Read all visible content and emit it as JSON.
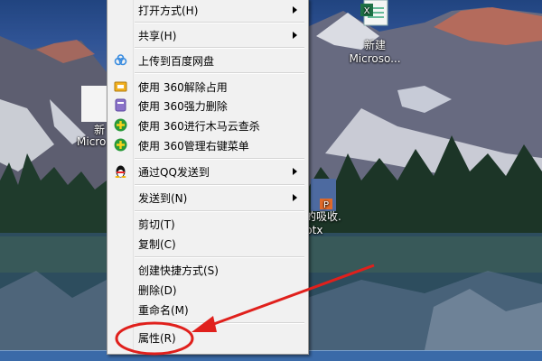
{
  "desktop": {
    "icons": [
      {
        "name": "desktop-icon-word-new",
        "label_line1": "新建",
        "label_line2": "Microso..."
      },
      {
        "name": "desktop-icon-left-partial",
        "label_line1": "新",
        "label_line2": "Micro"
      },
      {
        "name": "desktop-icon-ppt",
        "label_line1": "的吸收.",
        "label_line2": "ptx"
      }
    ]
  },
  "context_menu": {
    "items": [
      {
        "label": "打开方式(H)",
        "submenu": true
      },
      {
        "label": "共享(H)",
        "submenu": true
      },
      {
        "label": "上传到百度网盘",
        "icon": "baidu-cloud-icon"
      },
      {
        "label": "使用 360解除占用",
        "icon": "360-unlock-icon"
      },
      {
        "label": "使用 360强力删除",
        "icon": "360-shred-icon"
      },
      {
        "label": "使用 360进行木马云查杀",
        "icon": "360-scan-icon"
      },
      {
        "label": "使用 360管理右键菜单",
        "icon": "360-menu-manager-icon"
      },
      {
        "label": "通过QQ发送到",
        "icon": "qq-penguin-icon",
        "submenu": true
      },
      {
        "label": "发送到(N)",
        "submenu": true
      },
      {
        "label": "剪切(T)"
      },
      {
        "label": "复制(C)"
      },
      {
        "label": "创建快捷方式(S)"
      },
      {
        "label": "删除(D)"
      },
      {
        "label": "重命名(M)"
      },
      {
        "label": "属性(R)",
        "highlighted": true
      }
    ]
  },
  "annotation": {
    "arrow_color": "#e0201c",
    "circle_color": "#e0201c"
  }
}
